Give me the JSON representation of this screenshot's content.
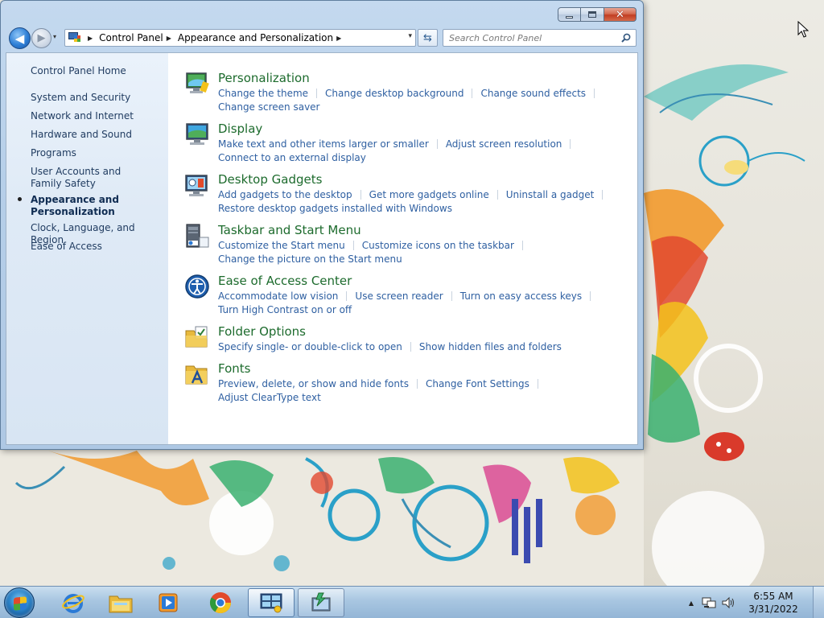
{
  "window": {
    "caption_buttons": {
      "minimize": "minimize",
      "maximize": "maximize",
      "close": "close"
    }
  },
  "nav": {
    "back_label": "◀",
    "forward_label": "▶",
    "recent_label": "▾",
    "breadcrumbs": [
      "Control Panel",
      "Appearance and Personalization"
    ],
    "breadcrumb_sep": "▶",
    "dropdown_label": "▾",
    "refresh_label": "⇆",
    "search_placeholder": "Search Control Panel"
  },
  "left_pane": {
    "items": [
      "Control Panel Home",
      "System and Security",
      "Network and Internet",
      "Hardware and Sound",
      "Programs",
      "User Accounts and Family Safety",
      "Appearance and Personalization",
      "Clock, Language, and Region",
      "Ease of Access"
    ],
    "active_index": 6
  },
  "categories": [
    {
      "title": "Personalization",
      "icon": "personalization-icon",
      "links": [
        "Change the theme",
        "Change desktop background",
        "Change sound effects",
        "Change screen saver"
      ]
    },
    {
      "title": "Display",
      "icon": "display-icon",
      "links": [
        "Make text and other items larger or smaller",
        "Adjust screen resolution",
        "Connect to an external display"
      ]
    },
    {
      "title": "Desktop Gadgets",
      "icon": "gadgets-icon",
      "links": [
        "Add gadgets to the desktop",
        "Get more gadgets online",
        "Uninstall a gadget",
        "Restore desktop gadgets installed with Windows"
      ]
    },
    {
      "title": "Taskbar and Start Menu",
      "icon": "taskbar-icon",
      "links": [
        "Customize the Start menu",
        "Customize icons on the taskbar",
        "Change the picture on the Start menu"
      ]
    },
    {
      "title": "Ease of Access Center",
      "icon": "ease-of-access-icon",
      "links": [
        "Accommodate low vision",
        "Use screen reader",
        "Turn on easy access keys",
        "Turn High Contrast on or off"
      ]
    },
    {
      "title": "Folder Options",
      "icon": "folder-options-icon",
      "links": [
        "Specify single- or double-click to open",
        "Show hidden files and folders"
      ]
    },
    {
      "title": "Fonts",
      "icon": "fonts-icon",
      "links": [
        "Preview, delete, or show and hide fonts",
        "Change Font Settings",
        "Adjust ClearType text"
      ]
    }
  ],
  "taskbar": {
    "pinned": [
      "internet-explorer-icon",
      "windows-explorer-icon",
      "media-player-icon",
      "chrome-icon",
      "control-panel-icon",
      "app-icon"
    ],
    "clock_time": "6:55 AM",
    "clock_date": "3/31/2022",
    "tray_arrow": "▲"
  },
  "colors": {
    "link": "#2e5fa1",
    "category_title": "#1d6b2d",
    "left_pane_text": "#1e3a5f"
  }
}
